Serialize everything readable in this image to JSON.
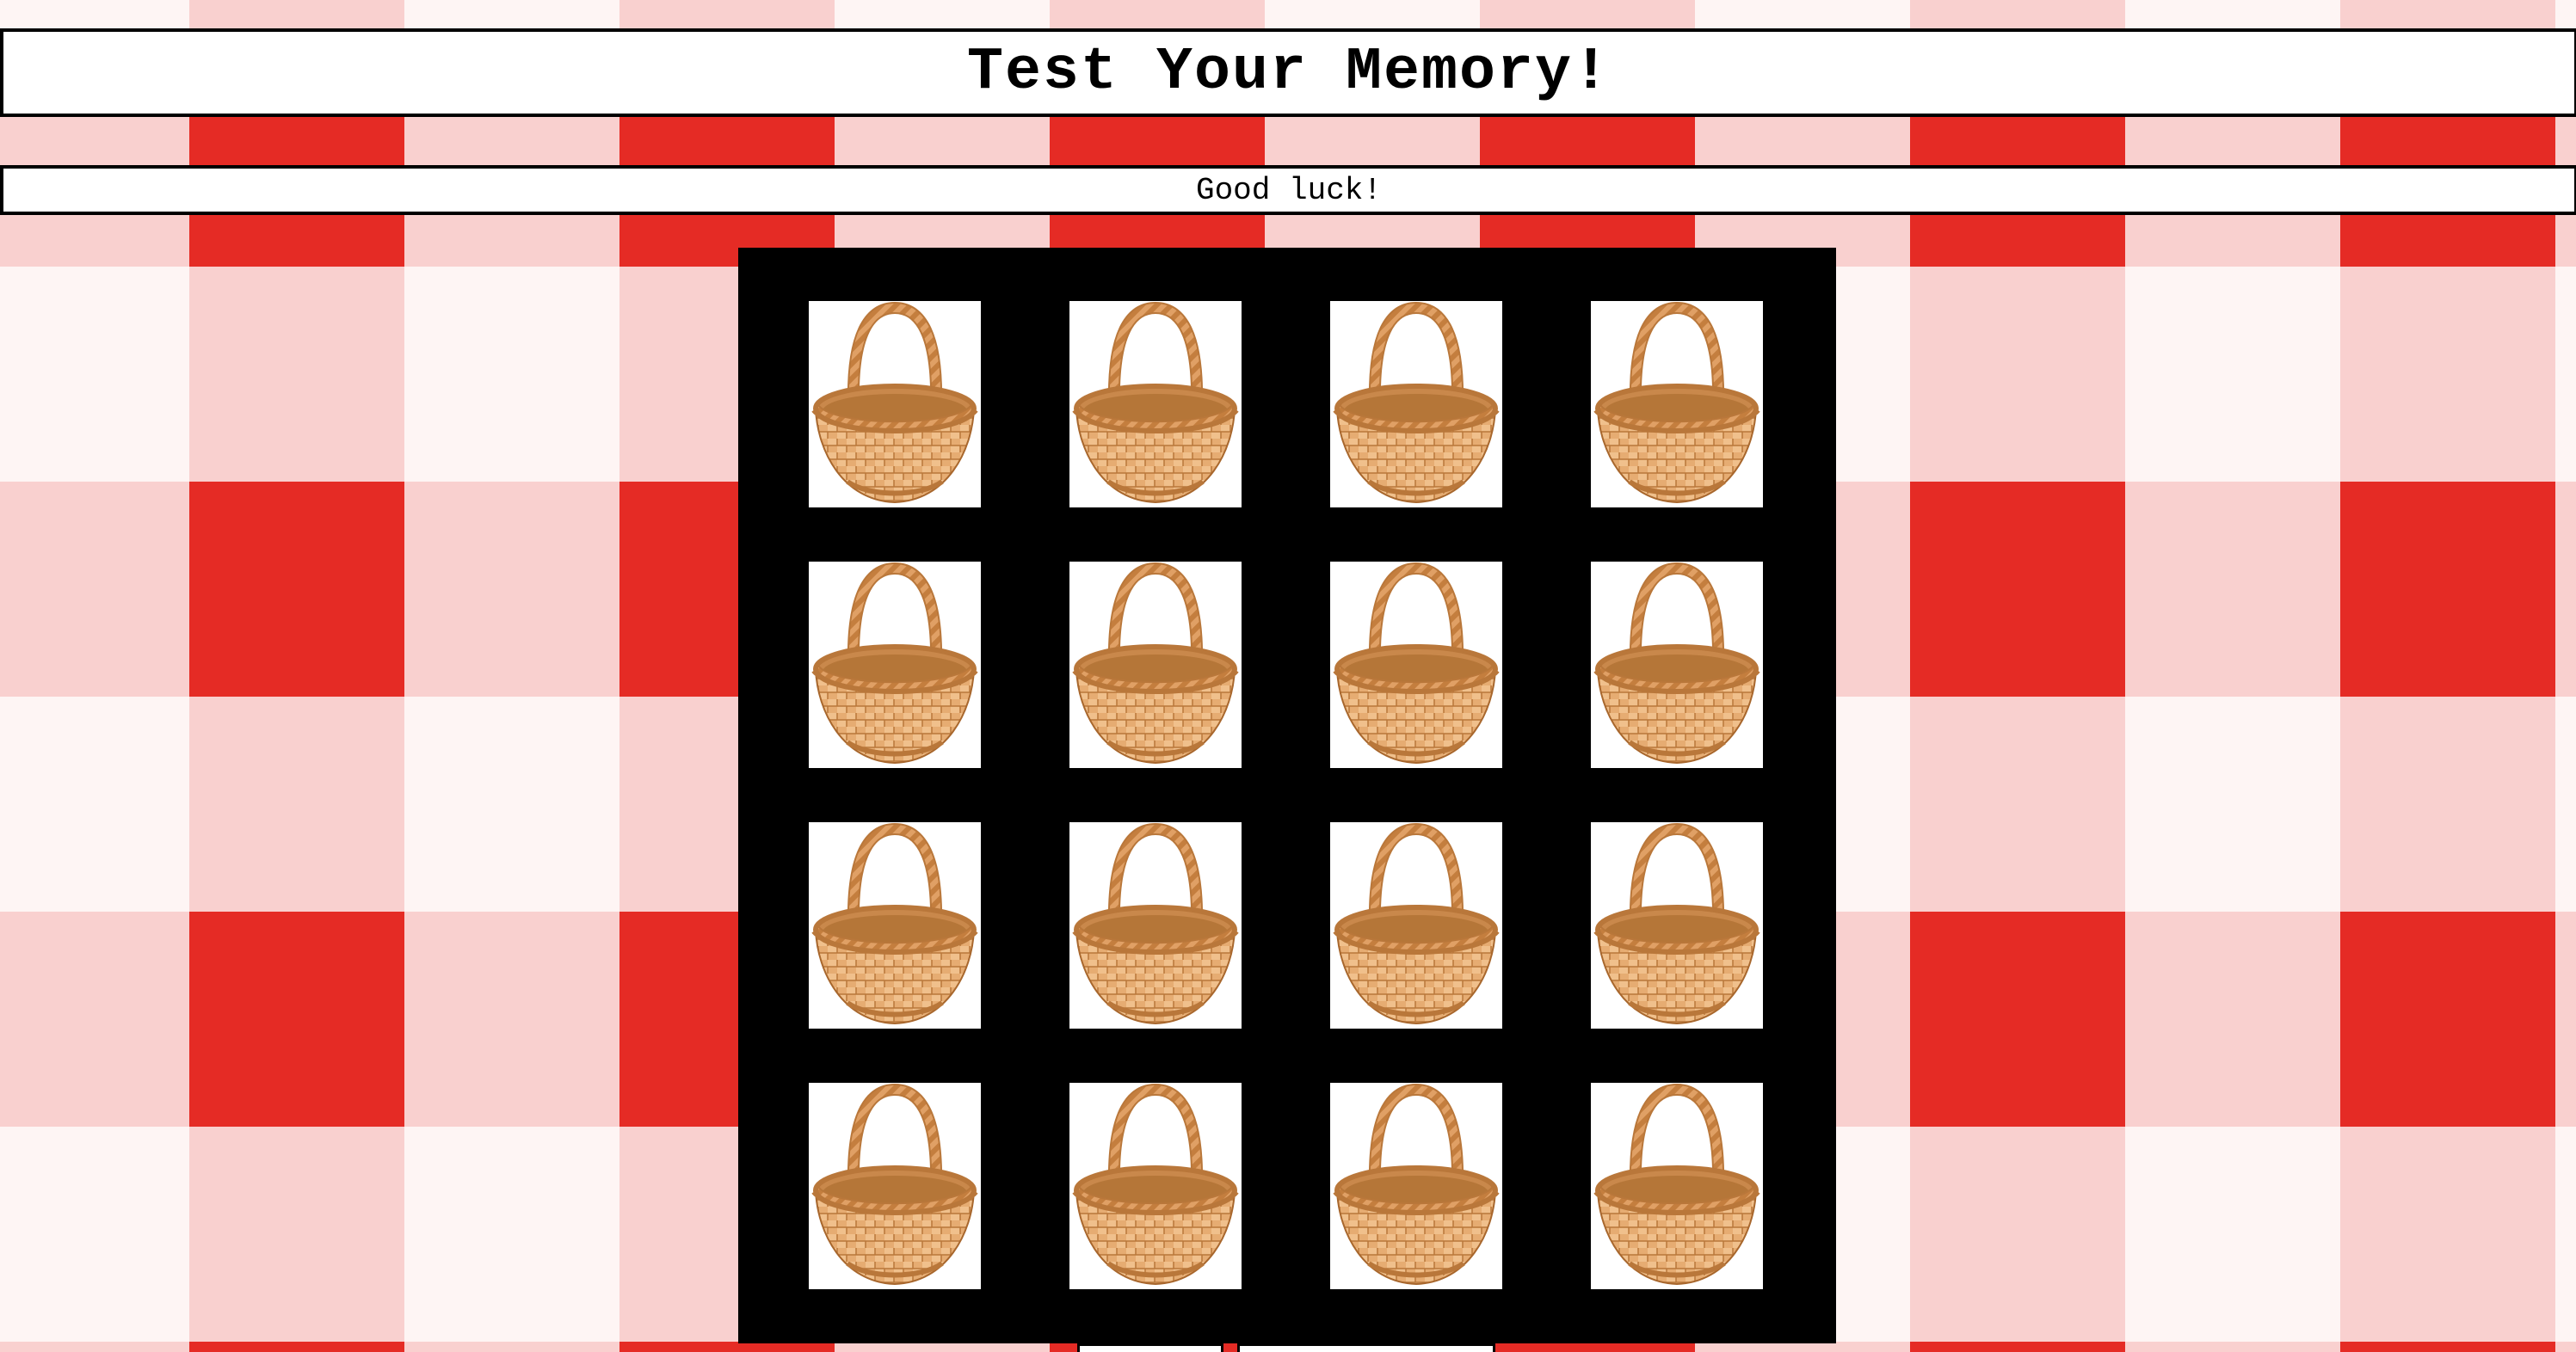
{
  "header": {
    "title": "Test Your Memory!"
  },
  "status": {
    "message": "Good luck!"
  },
  "board": {
    "rows": 4,
    "columns": 4,
    "card_back": "basket-icon",
    "cards": [
      {
        "face": "hidden"
      },
      {
        "face": "hidden"
      },
      {
        "face": "hidden"
      },
      {
        "face": "hidden"
      },
      {
        "face": "hidden"
      },
      {
        "face": "hidden"
      },
      {
        "face": "hidden"
      },
      {
        "face": "hidden"
      },
      {
        "face": "hidden"
      },
      {
        "face": "hidden"
      },
      {
        "face": "hidden"
      },
      {
        "face": "hidden"
      },
      {
        "face": "hidden"
      },
      {
        "face": "hidden"
      },
      {
        "face": "hidden"
      },
      {
        "face": "hidden"
      }
    ]
  },
  "colors": {
    "tablecloth_red": "#e52b25",
    "tablecloth_white": "#ffffff",
    "board_background": "#000000",
    "basket_light": "#e9b27a",
    "basket_dark": "#c98545"
  }
}
